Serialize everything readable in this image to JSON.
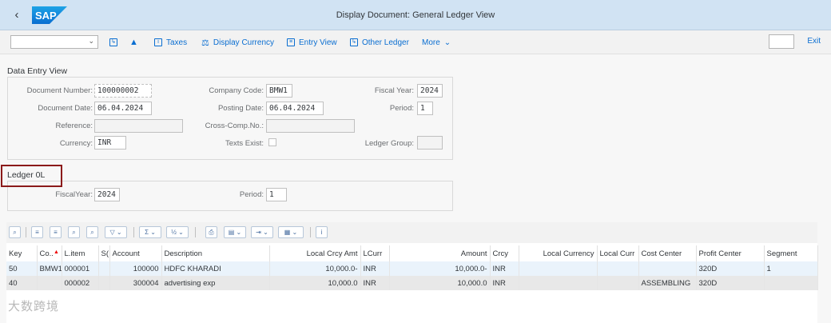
{
  "window": {
    "title": "Display Document: General Ledger View",
    "logo_text": "SAP"
  },
  "toolbar": {
    "select_value": "",
    "taxes": "Taxes",
    "display_currency": "Display Currency",
    "entry_view": "Entry View",
    "other_ledger": "Other Ledger",
    "more": "More",
    "exit": "Exit"
  },
  "data_entry": {
    "section_title": "Data Entry View",
    "document_number": {
      "label": "Document Number:",
      "value": "100000002"
    },
    "company_code": {
      "label": "Company Code:",
      "value": "BMW1"
    },
    "fiscal_year": {
      "label": "Fiscal Year:",
      "value": "2024"
    },
    "document_date": {
      "label": "Document Date:",
      "value": "06.04.2024"
    },
    "posting_date": {
      "label": "Posting Date:",
      "value": "06.04.2024"
    },
    "period": {
      "label": "Period:",
      "value": "1"
    },
    "reference": {
      "label": "Reference:",
      "value": ""
    },
    "cross_comp": {
      "label": "Cross-Comp.No.:",
      "value": ""
    },
    "currency": {
      "label": "Currency:",
      "value": "INR"
    },
    "texts_exist": {
      "label": "Texts Exist:"
    },
    "ledger_group": {
      "label": "Ledger Group:",
      "value": ""
    }
  },
  "ledger": {
    "section_title": "Ledger 0L",
    "fiscal_year": {
      "label": "FiscalYear:",
      "value": "2024"
    },
    "period": {
      "label": "Period:",
      "value": "1"
    }
  },
  "grid": {
    "columns": [
      "Key",
      "Co..",
      "L.item",
      "S(",
      "Account",
      "Description",
      "Local Crcy Amt",
      "LCurr",
      "Amount",
      "Crcy",
      "Local Currency",
      "Local Curr",
      "Cost Center",
      "Profit Center",
      "Segment"
    ],
    "rows": [
      [
        "50",
        "BMW1",
        "000001",
        "",
        "100000",
        "HDFC KHARADI",
        "10,000.0-",
        "INR",
        "10,000.0-",
        "INR",
        "",
        "",
        "",
        "320D",
        "1"
      ],
      [
        "40",
        "",
        "000002",
        "",
        "300004",
        "advertising exp",
        "10,000.0",
        "INR",
        "10,000.0",
        "INR",
        "",
        "",
        "ASSEMBLING",
        "320D",
        ""
      ]
    ]
  },
  "watermark": "大数跨境",
  "colors": {
    "shell": "#d1e3f3",
    "link": "#0a6ed1",
    "highlight": "#8b1a1a"
  }
}
